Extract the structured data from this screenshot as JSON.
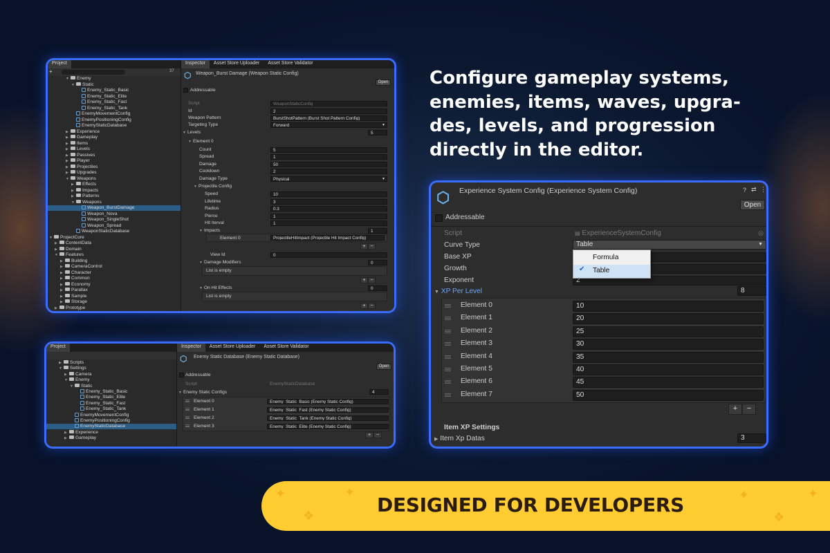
{
  "headline": {
    "lines": [
      "Configure gameplay systems,",
      "enemies, items, waves, upgra-",
      "des, levels, and progression",
      "directly in the editor."
    ]
  },
  "banner": {
    "text": "DESIGNED FOR DEVELOPERS"
  },
  "panel1": {
    "tabs": {
      "project": "Project",
      "inspector": "Inspector",
      "uploader": "Asset Store Uploader",
      "validator": "Asset Store Validator"
    },
    "search_count": "37",
    "tree": [
      {
        "label": "Enemy",
        "depth": 3,
        "type": "folder",
        "open": true
      },
      {
        "label": "Static",
        "depth": 4,
        "type": "folder",
        "open": true
      },
      {
        "label": "Enemy_Static_Basic",
        "depth": 5,
        "type": "so"
      },
      {
        "label": "Enemy_Static_Elite",
        "depth": 5,
        "type": "so"
      },
      {
        "label": "Enemy_Static_Fast",
        "depth": 5,
        "type": "so"
      },
      {
        "label": "Enemy_Static_Tank",
        "depth": 5,
        "type": "so"
      },
      {
        "label": "EnemyMovementConfig",
        "depth": 4,
        "type": "so"
      },
      {
        "label": "EnemyPositioningConfig",
        "depth": 4,
        "type": "so"
      },
      {
        "label": "EnemyStaticDatabase",
        "depth": 4,
        "type": "so"
      },
      {
        "label": "Experience",
        "depth": 3,
        "type": "folder"
      },
      {
        "label": "Gameplay",
        "depth": 3,
        "type": "folder"
      },
      {
        "label": "Items",
        "depth": 3,
        "type": "folder"
      },
      {
        "label": "Levels",
        "depth": 3,
        "type": "folder"
      },
      {
        "label": "Passives",
        "depth": 3,
        "type": "folder"
      },
      {
        "label": "Player",
        "depth": 3,
        "type": "folder"
      },
      {
        "label": "Projectiles",
        "depth": 3,
        "type": "folder"
      },
      {
        "label": "Upgrades",
        "depth": 3,
        "type": "folder"
      },
      {
        "label": "Weapons",
        "depth": 3,
        "type": "folder",
        "open": true
      },
      {
        "label": "Effects",
        "depth": 4,
        "type": "folder"
      },
      {
        "label": "Impacts",
        "depth": 4,
        "type": "folder"
      },
      {
        "label": "Patterns",
        "depth": 4,
        "type": "folder"
      },
      {
        "label": "Weapons",
        "depth": 4,
        "type": "folder",
        "open": true
      },
      {
        "label": "Weapon_BurstDamage",
        "depth": 5,
        "type": "so",
        "selected": true
      },
      {
        "label": "Weapon_Nova",
        "depth": 5,
        "type": "so"
      },
      {
        "label": "Weapon_SingleShot",
        "depth": 5,
        "type": "so"
      },
      {
        "label": "Weapon_Spread",
        "depth": 5,
        "type": "so"
      },
      {
        "label": "WeaponStaticDatabase",
        "depth": 4,
        "type": "so"
      },
      {
        "label": "ProjectCore",
        "depth": 0,
        "type": "folder",
        "open": true
      },
      {
        "label": "ContentData",
        "depth": 1,
        "type": "folder"
      },
      {
        "label": "Domain",
        "depth": 1,
        "type": "folder"
      },
      {
        "label": "Features",
        "depth": 1,
        "type": "folder",
        "open": true
      },
      {
        "label": "Building",
        "depth": 2,
        "type": "folder"
      },
      {
        "label": "CameraControl",
        "depth": 2,
        "type": "folder"
      },
      {
        "label": "Character",
        "depth": 2,
        "type": "folder"
      },
      {
        "label": "Common",
        "depth": 2,
        "type": "folder"
      },
      {
        "label": "Economy",
        "depth": 2,
        "type": "folder"
      },
      {
        "label": "Parallax",
        "depth": 2,
        "type": "folder"
      },
      {
        "label": "Sample",
        "depth": 2,
        "type": "folder"
      },
      {
        "label": "Storage",
        "depth": 2,
        "type": "folder"
      },
      {
        "label": "Prototype",
        "depth": 1,
        "type": "folder"
      },
      {
        "label": "Resources",
        "depth": 1,
        "type": "folder"
      }
    ],
    "inspector": {
      "title": "Weapon_Burst Damage (Weapon Static Config)",
      "open": "Open",
      "addressable": "Addressable",
      "rows": [
        {
          "label": "Script",
          "value": "WeaponStaticConfig",
          "indent": 0,
          "dim": true
        },
        {
          "label": "Id",
          "value": "2",
          "indent": 0
        },
        {
          "label": "Weapon Pattern",
          "value": "BurstShotPattern (Burst Shot Pattern Config)",
          "indent": 0
        },
        {
          "label": "Targeting Type",
          "value": "Forward",
          "indent": 0,
          "dropdown": true
        },
        {
          "label": "Levels",
          "value": "5",
          "indent": 0,
          "fold": true,
          "count": true
        },
        {
          "label": "Element 0",
          "value": "",
          "indent": 1,
          "fold": true
        },
        {
          "label": "Count",
          "value": "5",
          "indent": 2
        },
        {
          "label": "Spread",
          "value": "1",
          "indent": 2
        },
        {
          "label": "Damage",
          "value": "50",
          "indent": 2
        },
        {
          "label": "Cooldown",
          "value": "2",
          "indent": 2
        },
        {
          "label": "Damage Type",
          "value": "Physical",
          "indent": 2,
          "dropdown": true
        },
        {
          "label": "Projectile Config",
          "value": "",
          "indent": 2,
          "fold": true
        },
        {
          "label": "Speed",
          "value": "10",
          "indent": 3
        },
        {
          "label": "Lifetime",
          "value": "3",
          "indent": 3
        },
        {
          "label": "Radius",
          "value": "0.3",
          "indent": 3
        },
        {
          "label": "Pierce",
          "value": "1",
          "indent": 3
        },
        {
          "label": "Hit Iterval",
          "value": "1",
          "indent": 3
        },
        {
          "label": "Impacts",
          "value": "1",
          "indent": 3,
          "fold": true,
          "count": true
        }
      ],
      "impact_element": {
        "label": "Element 0",
        "value": "ProjectileHitImpact (Projectile Hit Impact Config)"
      },
      "view_id": {
        "label": "View Id",
        "value": "0"
      },
      "damage_modifiers": {
        "label": "Damage Modifiers",
        "count": "0",
        "empty": "List is empty"
      },
      "on_hit_effects": {
        "label": "On Hit Effects",
        "count": "0",
        "empty": "List is empty"
      }
    }
  },
  "panel2": {
    "tabs": {
      "project": "Project",
      "inspector": "Inspector",
      "uploader": "Asset Store Uploader",
      "validator": "Asset Store Validator"
    },
    "tree": [
      {
        "label": "Scripts",
        "depth": 2,
        "type": "folder"
      },
      {
        "label": "Settings",
        "depth": 2,
        "type": "folder",
        "open": true
      },
      {
        "label": "Camera",
        "depth": 3,
        "type": "folder"
      },
      {
        "label": "Enemy",
        "depth": 3,
        "type": "folder",
        "open": true
      },
      {
        "label": "Static",
        "depth": 4,
        "type": "folder",
        "open": true
      },
      {
        "label": "Enemy_Static_Basic",
        "depth": 5,
        "type": "so"
      },
      {
        "label": "Enemy_Static_Elite",
        "depth": 5,
        "type": "so"
      },
      {
        "label": "Enemy_Static_Fast",
        "depth": 5,
        "type": "so"
      },
      {
        "label": "Enemy_Static_Tank",
        "depth": 5,
        "type": "so"
      },
      {
        "label": "EnemyMovementConfig",
        "depth": 4,
        "type": "so"
      },
      {
        "label": "EnemyPositioningConfig",
        "depth": 4,
        "type": "so"
      },
      {
        "label": "EnemyStaticDatabase",
        "depth": 4,
        "type": "so",
        "selected": true
      },
      {
        "label": "Experience",
        "depth": 3,
        "type": "folder"
      },
      {
        "label": "Gameplay",
        "depth": 3,
        "type": "folder"
      }
    ],
    "inspector": {
      "title": "Enemy Static Database (Enemy Static Database)",
      "open": "Open",
      "addressable": "Addressable",
      "script_label": "Script",
      "script_value": "EnemyStaticDatabase",
      "list_label": "Enemy Static Configs",
      "list_count": "4",
      "elements": [
        {
          "label": "Element 0",
          "value": "Enemy_Static_Basic (Enemy Static Config)"
        },
        {
          "label": "Element 1",
          "value": "Enemy_Static_Fast (Enemy Static Config)"
        },
        {
          "label": "Element 2",
          "value": "Enemy_Static_Tank (Enemy Static Config)"
        },
        {
          "label": "Element 3",
          "value": "Enemy_Static_Elite (Enemy Static Config)"
        }
      ]
    }
  },
  "panel3": {
    "title": "Experience System Config (Experience System Config)",
    "open": "Open",
    "addressable": "Addressable",
    "script": {
      "label": "Script",
      "value": "ExperienceSystemConfig"
    },
    "curve_type": {
      "label": "Curve Type",
      "value": "Table"
    },
    "base_xp": {
      "label": "Base XP"
    },
    "growth": {
      "label": "Growth"
    },
    "exponent": {
      "label": "Exponent",
      "value": "2"
    },
    "dropdown": {
      "options": [
        "Formula",
        "Table"
      ],
      "selected": "Table"
    },
    "xp_per_level": {
      "label": "XP Per Level",
      "count": "8",
      "elements": [
        {
          "label": "Element 0",
          "value": "10"
        },
        {
          "label": "Element 1",
          "value": "20"
        },
        {
          "label": "Element 2",
          "value": "25"
        },
        {
          "label": "Element 3",
          "value": "30"
        },
        {
          "label": "Element 4",
          "value": "35"
        },
        {
          "label": "Element 5",
          "value": "40"
        },
        {
          "label": "Element 6",
          "value": "45"
        },
        {
          "label": "Element 7",
          "value": "50"
        }
      ]
    },
    "item_xp_settings": {
      "label": "Item XP Settings"
    },
    "item_xp_datas": {
      "label": "Item Xp Datas",
      "count": "3"
    }
  }
}
